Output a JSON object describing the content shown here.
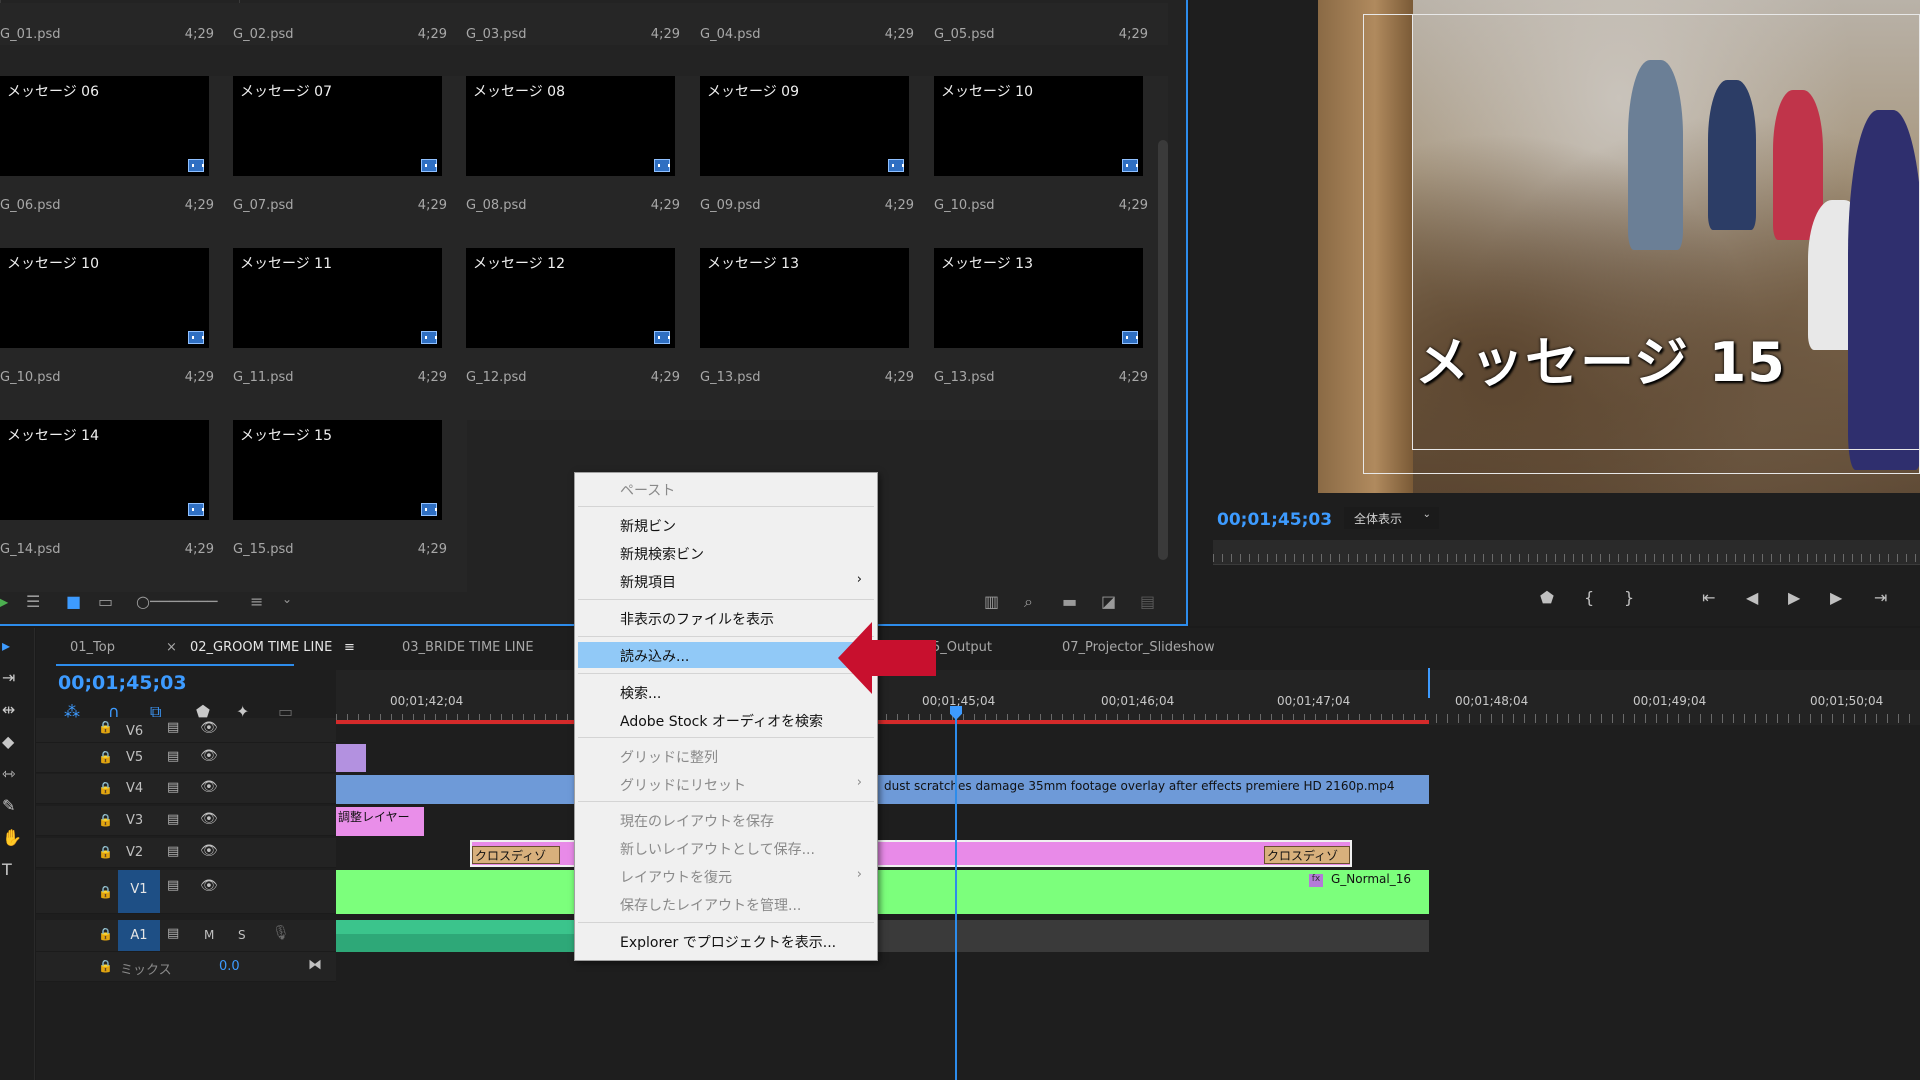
{
  "project": {
    "row0": [
      {
        "fname": "G_01.psd",
        "dur": "4;29"
      },
      {
        "fname": "G_02.psd",
        "dur": "4;29"
      },
      {
        "fname": "G_03.psd",
        "dur": "4;29"
      },
      {
        "fname": "G_04.psd",
        "dur": "4;29"
      },
      {
        "fname": "G_05.psd",
        "dur": "4;29"
      }
    ],
    "row1": [
      {
        "title": "メッセージ 06",
        "fname": "G_06.psd",
        "dur": "4;29"
      },
      {
        "title": "メッセージ 07",
        "fname": "G_07.psd",
        "dur": "4;29"
      },
      {
        "title": "メッセージ 08",
        "fname": "G_08.psd",
        "dur": "4;29"
      },
      {
        "title": "メッセージ 09",
        "fname": "G_09.psd",
        "dur": "4;29"
      },
      {
        "title": "メッセージ 10",
        "fname": "G_10.psd",
        "dur": "4;29"
      }
    ],
    "row2": [
      {
        "title": "メッセージ 10",
        "fname": "G_10.psd",
        "dur": "4;29"
      },
      {
        "title": "メッセージ 11",
        "fname": "G_11.psd",
        "dur": "4;29"
      },
      {
        "title": "メッセージ 12",
        "fname": "G_12.psd",
        "dur": "4;29"
      },
      {
        "title": "メッセージ 13",
        "fname": "G_13.psd",
        "dur": "4;29"
      },
      {
        "title": "メッセージ 13",
        "fname": "G_13.psd",
        "dur": "4;29"
      }
    ],
    "row3": [
      {
        "title": "メッセージ 14",
        "fname": "G_14.psd",
        "dur": "4;29"
      },
      {
        "title": "メッセージ 15",
        "fname": "G_15.psd",
        "dur": "4;29"
      }
    ]
  },
  "program": {
    "overlay_title": "メッセージ 15",
    "timecode": "00;01;45;03",
    "zoom": "全体表示"
  },
  "timeline": {
    "tabs": [
      "01_Top",
      "02_GROOM TIME LINE",
      "03_BRIDE TIME LINE",
      "5_Output",
      "07_Projector_Slideshow"
    ],
    "close_mark": "×",
    "tab_menu_icon": "≡",
    "timecode": "00;01;45;03",
    "ruler": [
      "00;01;42;04",
      "00;01;45;04",
      "00;01;46;04",
      "00;01;47;04",
      "00;01;48;04",
      "00;01;49;04",
      "00;01;50;04"
    ],
    "tracks": [
      "V6",
      "V5",
      "V4",
      "V3",
      "V2",
      "V1",
      "A1"
    ],
    "audio_m": "M",
    "audio_s": "S",
    "mix_label": "ミックス",
    "mix_value": "0.0",
    "clips": {
      "v4_overlay": "dust scratches damage 35mm footage overlay after effects premiere HD 2160p.mp4",
      "v3_adjust": "調整レイヤー",
      "v2_cross_left": "クロスディゾ",
      "v2_cross_right": "クロスディゾ",
      "v1_clip": "G_Normal_16",
      "fx": "fx"
    }
  },
  "context_menu": {
    "items": [
      {
        "label": "ペースト",
        "disabled": true
      },
      {
        "label": "新規ビン"
      },
      {
        "label": "新規検索ビン"
      },
      {
        "label": "新規項目",
        "submenu": true
      },
      {
        "label": "非表示のファイルを表示"
      },
      {
        "label": "読み込み...",
        "highlighted": true
      },
      {
        "label": "検索..."
      },
      {
        "label": "Adobe Stock オーディオを検索"
      },
      {
        "label": "グリッドに整列",
        "disabled": true
      },
      {
        "label": "グリッドにリセット",
        "disabled": true,
        "submenu": true
      },
      {
        "label": "現在のレイアウトを保存",
        "disabled": true
      },
      {
        "label": "新しいレイアウトとして保存...",
        "disabled": true
      },
      {
        "label": "レイアウトを復元",
        "disabled": true,
        "submenu": true
      },
      {
        "label": "保存したレイアウトを管理...",
        "disabled": true
      },
      {
        "label": "Explorer でプロジェクトを表示..."
      }
    ],
    "submenu_glyph": "›"
  },
  "colors": {
    "accent": "#2d8ceb",
    "timecode": "#3d9bff",
    "menu_highlight": "#91c9f7",
    "arrow": "#c8102e",
    "v1_clip": "#7cff7c",
    "v4_clip": "#6e9ad8",
    "v2_clip": "#e88ae8",
    "v3_clip": "#e98ee9",
    "a1_clip": "#2ea878",
    "workarea": "#d42a2a"
  }
}
